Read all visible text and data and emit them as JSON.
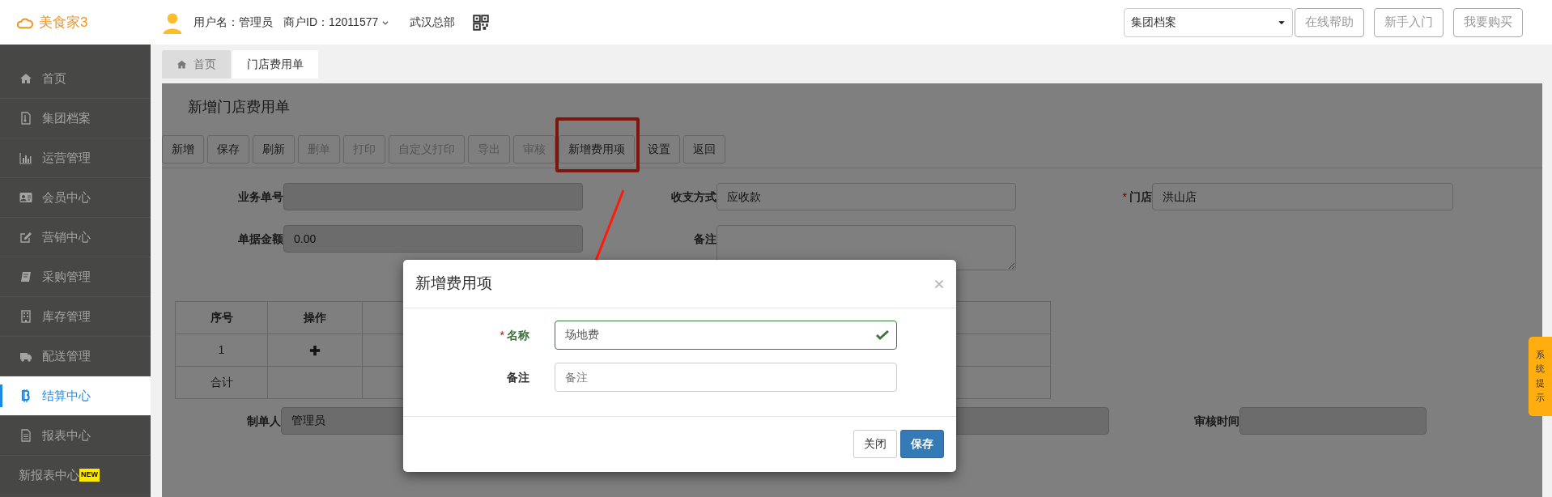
{
  "header": {
    "logo": "美食家3",
    "user": "用户名：管理员",
    "merchant": "商户ID：12011577",
    "org": "武汉总部",
    "archive_select": "集团档案",
    "buttons": [
      "在线帮助",
      "新手入门",
      "我要购买"
    ]
  },
  "sidebar": {
    "items": [
      {
        "label": "首页",
        "selected": false
      },
      {
        "label": "集团档案",
        "selected": false
      },
      {
        "label": "运营管理",
        "selected": false
      },
      {
        "label": "会员中心",
        "selected": false
      },
      {
        "label": "营销中心",
        "selected": false
      },
      {
        "label": "采购管理",
        "selected": false
      },
      {
        "label": "库存管理",
        "selected": false
      },
      {
        "label": "配送管理",
        "selected": false
      },
      {
        "label": "结算中心",
        "selected": true
      },
      {
        "label": "报表中心",
        "selected": false
      },
      {
        "label": "新报表中心",
        "badge": "NEW",
        "selected": false
      }
    ]
  },
  "tabs": [
    {
      "label": "首页",
      "selected": false
    },
    {
      "label": "门店费用单",
      "selected": true
    }
  ],
  "page_title": "新增门店费用单",
  "toolbar": [
    {
      "label": "新增",
      "disabled": false,
      "highlighted": false
    },
    {
      "label": "保存",
      "disabled": false,
      "highlighted": false
    },
    {
      "label": "刷新",
      "disabled": false,
      "highlighted": false
    },
    {
      "label": "删单",
      "disabled": true,
      "highlighted": false
    },
    {
      "label": "打印",
      "disabled": true,
      "highlighted": false
    },
    {
      "label": "自定义打印",
      "disabled": true,
      "highlighted": false
    },
    {
      "label": "导出",
      "disabled": true,
      "highlighted": false
    },
    {
      "label": "审核",
      "disabled": true,
      "highlighted": false
    },
    {
      "label": "新增费用项",
      "disabled": false,
      "highlighted": true
    },
    {
      "label": "设置",
      "disabled": false,
      "highlighted": false
    },
    {
      "label": "返回",
      "disabled": false,
      "highlighted": false
    }
  ],
  "form": {
    "rows": [
      [
        {
          "label": "业务单号",
          "kind": "input",
          "readonly": true
        },
        {
          "label": "收支方式",
          "kind": "select",
          "value": "应收款"
        },
        {
          "label": "门店",
          "kind": "select",
          "value": "洪山店",
          "marker": "*"
        }
      ],
      [
        {
          "label": "单据金额",
          "kind": "input",
          "readonly": true,
          "value": "0.00"
        },
        {
          "label": "备注",
          "kind": "textarea"
        }
      ]
    ]
  },
  "table": {
    "columns": [
      "序号",
      "操作"
    ],
    "rows": [
      {
        "index": "1"
      }
    ],
    "footer": "合计"
  },
  "form_bottom": [
    {
      "label": "制单人",
      "kind": "input",
      "readonly": true,
      "value": "管理员"
    },
    {
      "kind": "input",
      "readonly": true
    },
    {
      "label": "审核时间",
      "kind": "input",
      "readonly": true
    }
  ],
  "modal": {
    "title": "新增费用项",
    "fields": [
      {
        "label": "名称",
        "marker": "*",
        "value": "场地费",
        "valid": true
      },
      {
        "label": "备注",
        "placeholder": "备注",
        "valid": false
      }
    ],
    "buttons": [
      {
        "label": "关闭",
        "kind": "default"
      },
      {
        "label": "保存",
        "kind": "primary"
      }
    ]
  },
  "side_tab": "系统提示"
}
